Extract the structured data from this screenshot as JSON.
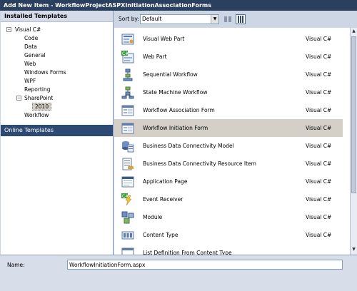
{
  "window": {
    "title": "Add New Item - WorkflowProjectASPXInitiationAssociationForms"
  },
  "left": {
    "header": "Installed Templates",
    "tree": [
      {
        "label": "Visual C#",
        "expander": "−"
      },
      {
        "label": "Code"
      },
      {
        "label": "Data"
      },
      {
        "label": "General"
      },
      {
        "label": "Web"
      },
      {
        "label": "Windows Forms"
      },
      {
        "label": "WPF"
      },
      {
        "label": "Reporting"
      },
      {
        "label": "SharePoint",
        "expander": "−"
      },
      {
        "label": "2010"
      },
      {
        "label": "Workflow"
      }
    ],
    "online": "Online Templates"
  },
  "toolbar": {
    "sort_label": "Sort by:",
    "sort_value": "Default"
  },
  "items": [
    {
      "name": "Visual Web Part",
      "type": "Visual C#",
      "icon": "web-part-icon"
    },
    {
      "name": "Web Part",
      "type": "Visual C#",
      "icon": "csharp-web-part-icon"
    },
    {
      "name": "Sequential Workflow",
      "type": "Visual C#",
      "icon": "workflow-icon"
    },
    {
      "name": "State Machine Workflow",
      "type": "Visual C#",
      "icon": "state-machine-icon"
    },
    {
      "name": "Workflow Association Form",
      "type": "Visual C#",
      "icon": "form-icon"
    },
    {
      "name": "Workflow Initiation Form",
      "type": "Visual C#",
      "icon": "form-icon"
    },
    {
      "name": "Business Data Connectivity Model",
      "type": "Visual C#",
      "icon": "bdc-model-icon"
    },
    {
      "name": "Business Data Connectivity Resource Item",
      "type": "Visual C#",
      "icon": "bdc-resource-icon"
    },
    {
      "name": "Application Page",
      "type": "Visual C#",
      "icon": "application-page-icon"
    },
    {
      "name": "Event Receiver",
      "type": "Visual C#",
      "icon": "event-receiver-icon"
    },
    {
      "name": "Module",
      "type": "Visual C#",
      "icon": "module-icon"
    },
    {
      "name": "Content Type",
      "type": "Visual C#",
      "icon": "content-type-icon"
    },
    {
      "name": "List Definition From Content Type",
      "type": "",
      "icon": "list-definition-icon"
    }
  ],
  "bottom": {
    "name_label": "Name:",
    "name_value": "WorkflowInitiationForm.aspx"
  }
}
